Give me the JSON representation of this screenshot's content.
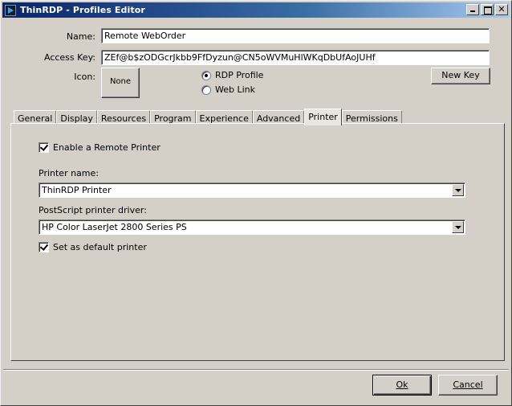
{
  "window": {
    "title": "ThinRDP - Profiles Editor",
    "min_label": "",
    "max_label": "",
    "close_label": "✕"
  },
  "profile": {
    "name_label": "Name:",
    "name_value": "Remote WebOrder",
    "key_label": "Access Key:",
    "key_value": "ZEf@b$zODGcrJkbb9FfDyzun@CN5oWVMuHlWKqDbUfAoJUHf",
    "icon_label": "Icon:",
    "icon_button": "None",
    "radio_rdp": "RDP Profile",
    "radio_web": "Web Link",
    "selected_type": "rdp",
    "new_key_button": "New Key"
  },
  "tabs": [
    {
      "label": "General"
    },
    {
      "label": "Display"
    },
    {
      "label": "Resources"
    },
    {
      "label": "Program"
    },
    {
      "label": "Experience"
    },
    {
      "label": "Advanced"
    },
    {
      "label": "Printer"
    },
    {
      "label": "Permissions"
    }
  ],
  "active_tab": "Printer",
  "printer": {
    "enable_label": "Enable a Remote Printer",
    "enable_checked": true,
    "name_label": "Printer name:",
    "name_value": "ThinRDP Printer",
    "driver_label": "PostScript printer driver:",
    "driver_value": "HP Color LaserJet 2800 Series PS",
    "default_label": "Set as default printer",
    "default_checked": true
  },
  "footer": {
    "ok_label": "Ok",
    "cancel_label": "Cancel"
  }
}
